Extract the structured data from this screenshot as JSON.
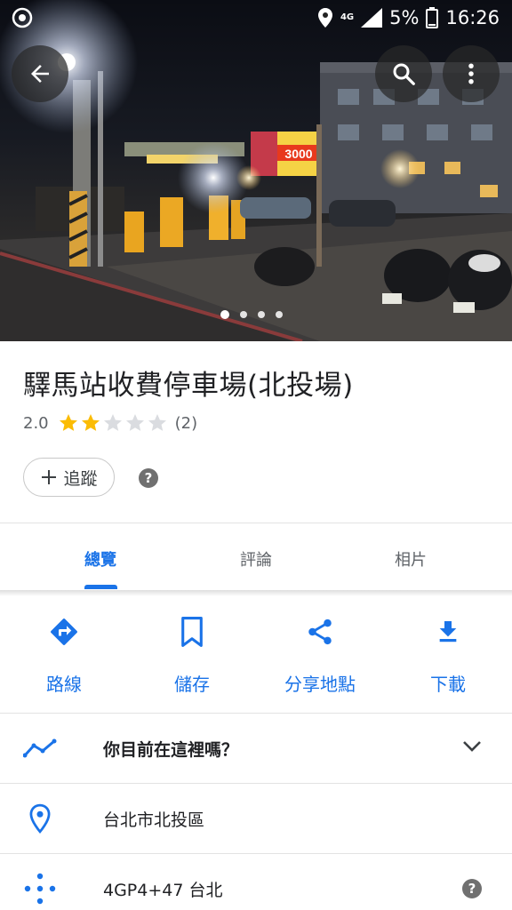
{
  "status_bar": {
    "network": "4G",
    "battery_percent": "5%",
    "time": "16:26"
  },
  "hero": {
    "photo_count": 4,
    "active_photo": 1,
    "sign_text": "3000"
  },
  "place": {
    "name": "驛馬站收費停車場(北投場)",
    "rating": "2.0",
    "rating_value": 2,
    "max_stars": 5,
    "review_count": "(2)",
    "follow_label": "追蹤"
  },
  "tabs": [
    {
      "label": "總覽",
      "active": true
    },
    {
      "label": "評論",
      "active": false
    },
    {
      "label": "相片",
      "active": false
    }
  ],
  "actions": [
    {
      "label": "路線",
      "icon": "directions-icon"
    },
    {
      "label": "儲存",
      "icon": "bookmark-icon"
    },
    {
      "label": "分享地點",
      "icon": "share-icon"
    },
    {
      "label": "下載",
      "icon": "download-icon"
    }
  ],
  "rows": {
    "here_prompt": "你目前在這裡嗎？",
    "address": "台北市北投區",
    "plus_code": "4GP4+47 台北"
  },
  "colors": {
    "accent": "#1a73e8",
    "star": "#fbbc04",
    "star_empty": "#dadce0"
  }
}
